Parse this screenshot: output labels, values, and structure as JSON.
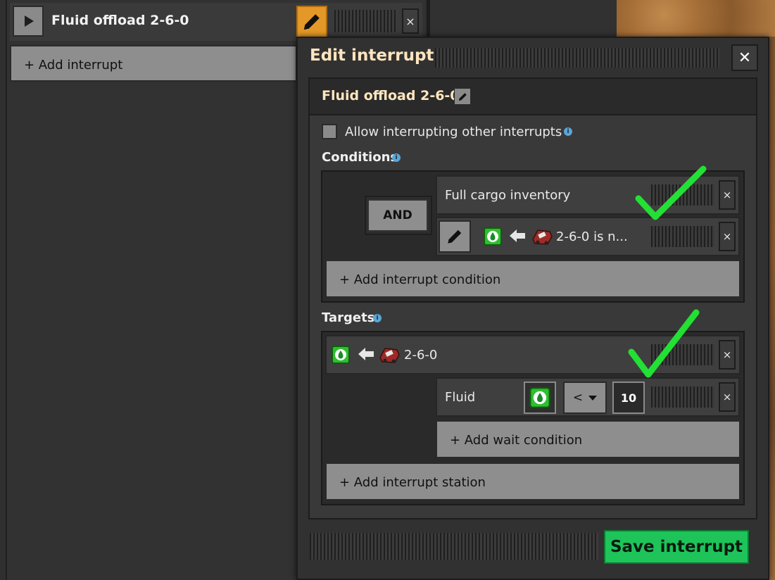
{
  "schedule": {
    "title": "Fluid offload 2-6-0",
    "add_interrupt_label": "+ Add interrupt",
    "close_label": "×"
  },
  "dialog": {
    "title": "Edit interrupt",
    "close_label": "✕",
    "interrupt_name": "Fluid offload 2-6-0",
    "allow_label": "Allow interrupting other interrupts",
    "allow_checked": false,
    "conditions_label": "Conditions",
    "and_label": "AND",
    "conditions": [
      {
        "text": "Full cargo inventory"
      },
      {
        "text": "2-6-0 is n..."
      }
    ],
    "add_condition_label": "+ Add interrupt condition",
    "targets_label": "Targets",
    "target": {
      "text": "2-6-0"
    },
    "wait": {
      "text": "Fluid",
      "comparator": "<",
      "value": "10"
    },
    "add_wait_label": "+ Add wait condition",
    "add_station_label": "+ Add interrupt station",
    "save_label": "Save interrupt",
    "row_close_label": "×",
    "info_glyph": "i"
  },
  "icons": [
    "play-icon",
    "pencil-icon",
    "fluid-tank-icon",
    "arrow-left-icon",
    "locomotive-icon",
    "info-icon",
    "check-mark-icon"
  ],
  "colors": {
    "accent_orange": "#e39827",
    "save_green": "#1ec45a",
    "check_green": "#22e034",
    "title_cream": "#ffe6c0"
  }
}
